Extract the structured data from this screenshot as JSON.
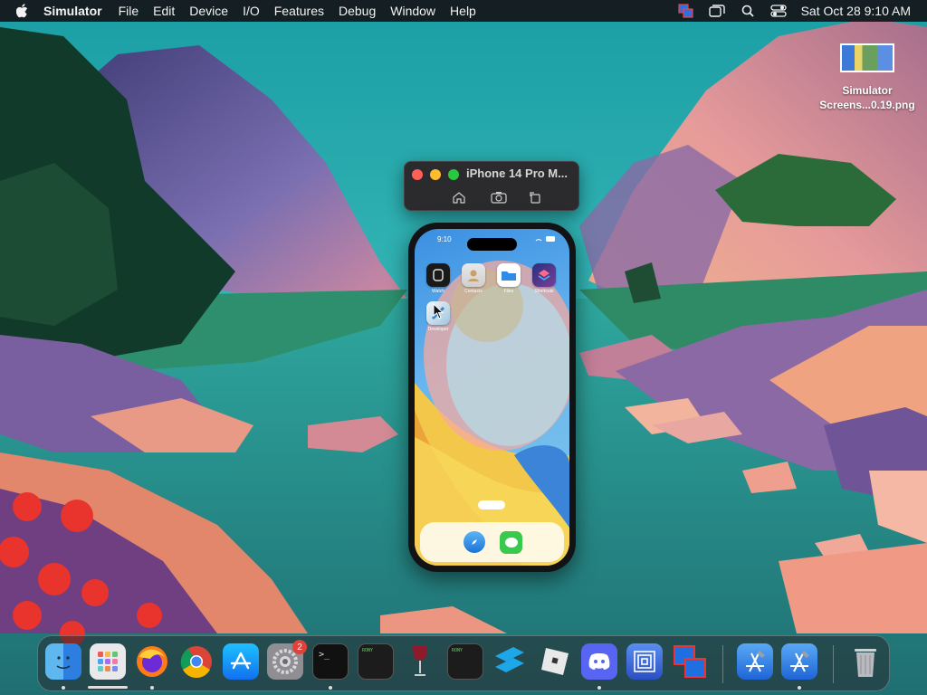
{
  "menubar": {
    "app_name": "Simulator",
    "items": [
      "File",
      "Edit",
      "Device",
      "I/O",
      "Features",
      "Debug",
      "Window",
      "Help"
    ],
    "clock": "Sat Oct 28  9:10 AM"
  },
  "desktop_file": {
    "line1": "Simulator",
    "line2": "Screens...0.19.png"
  },
  "simulator_window": {
    "title": "iPhone 14 Pro M..."
  },
  "phone": {
    "time": "9:10",
    "apps": [
      "Watch",
      "Contacts",
      "Files",
      "Shortcuts",
      "Developer"
    ]
  },
  "dock": {
    "settings_badge": "2",
    "terminal_prompt": ">_",
    "log_label": "RONY"
  },
  "colors": {
    "close": "#ff5f57",
    "minimize": "#febc2e",
    "zoom": "#28c840",
    "menubar_bg": "#141418"
  }
}
